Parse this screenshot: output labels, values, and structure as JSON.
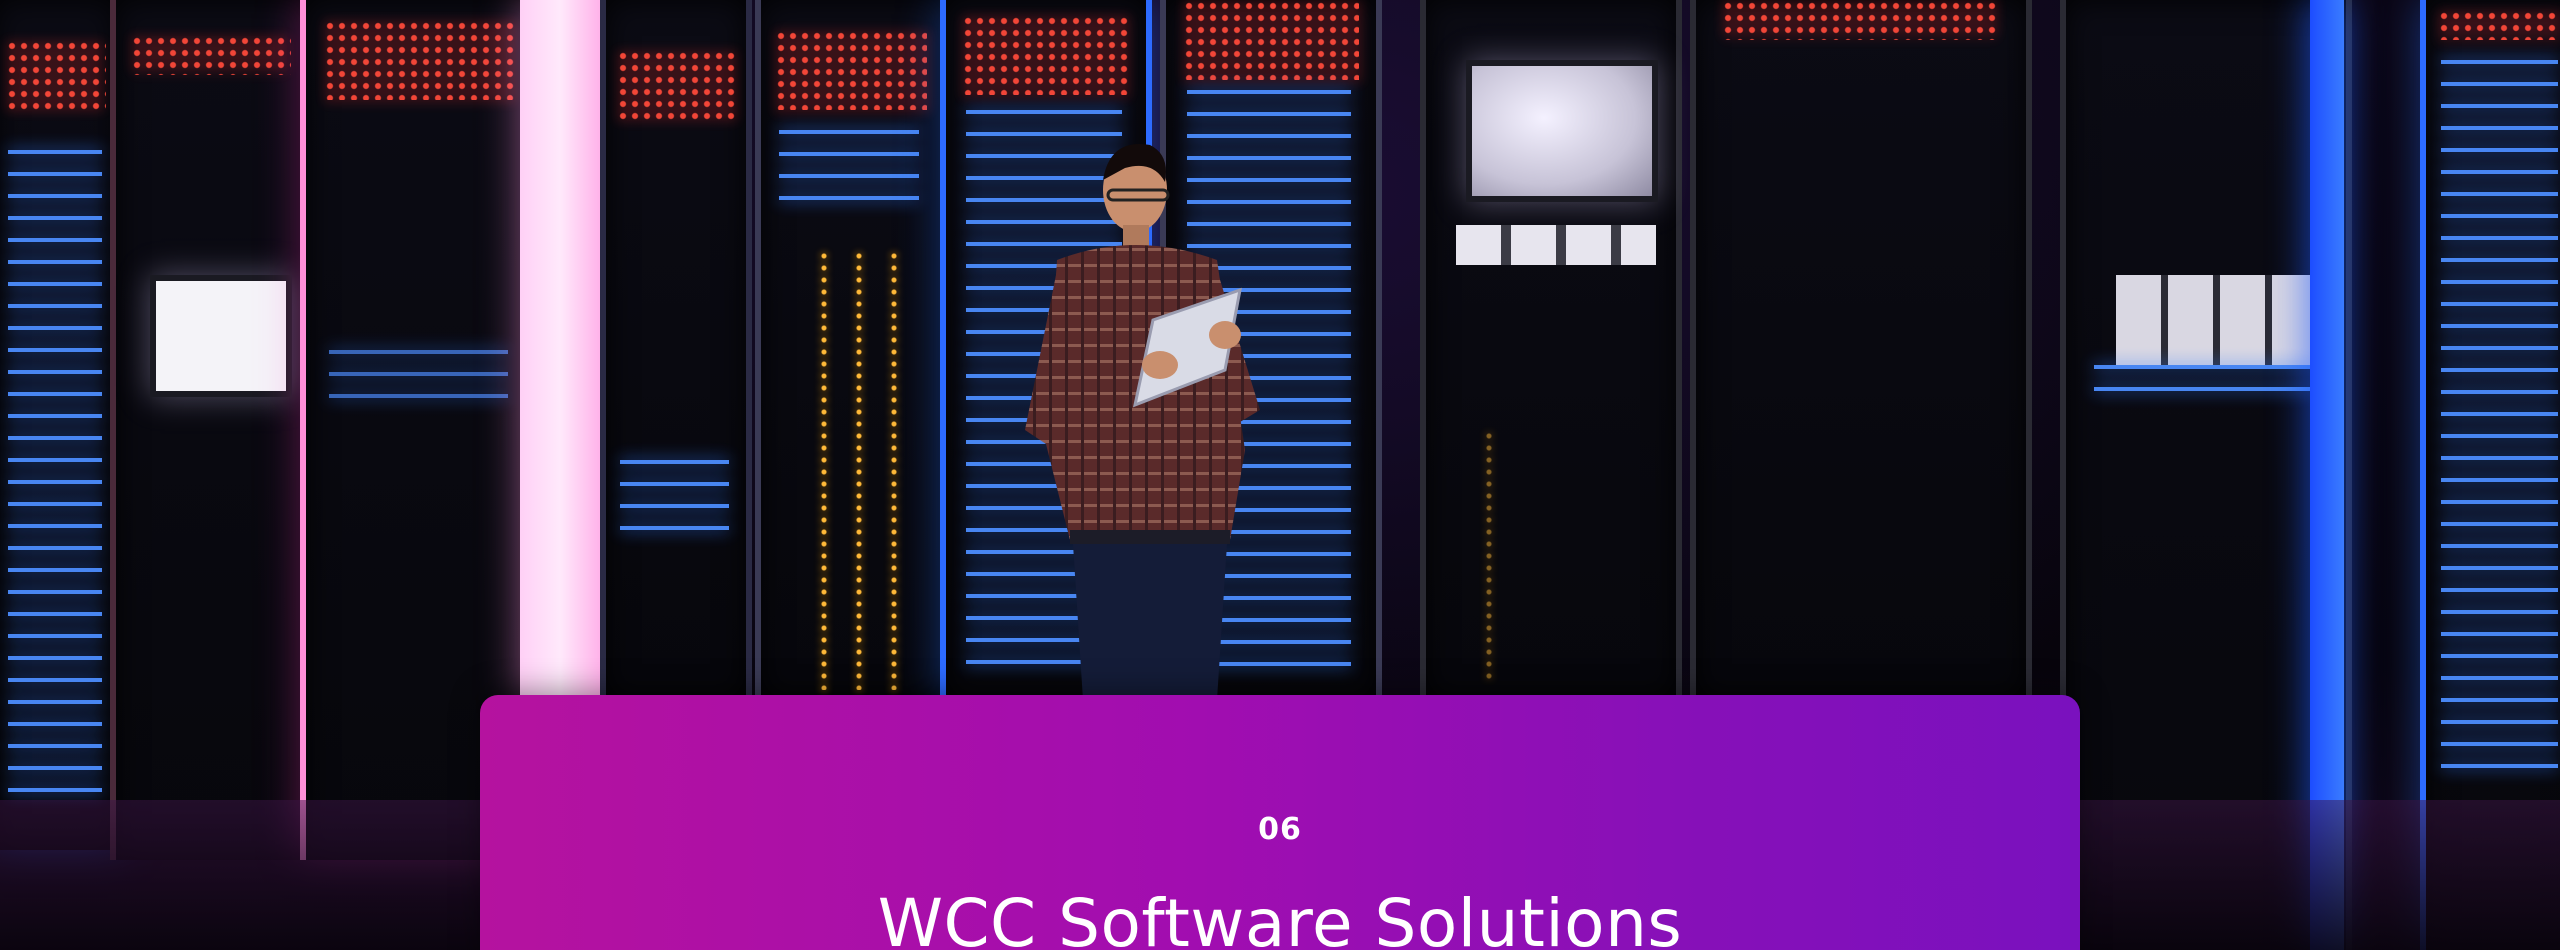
{
  "colors": {
    "card_gradient_start": "#b5129f",
    "card_gradient_end": "#7a11be",
    "text": "#ffffff",
    "led_red": "#ff4a3a",
    "led_blue": "#4c8dff"
  },
  "hero": {
    "image_icon": "server-room-photo",
    "section_number": "06",
    "section_title": "WCC Software Solutions"
  }
}
